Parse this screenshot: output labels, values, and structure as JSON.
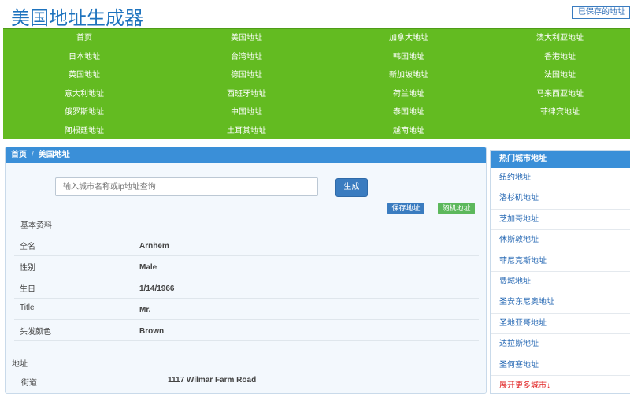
{
  "header": {
    "title": "美国地址生成器",
    "saved_label": "已保存的地址"
  },
  "nav": {
    "items": [
      "首页",
      "美国地址",
      "加拿大地址",
      "澳大利亚地址",
      "日本地址",
      "台湾地址",
      "韩国地址",
      "香港地址",
      "英国地址",
      "德国地址",
      "新加坡地址",
      "法国地址",
      "意大利地址",
      "西班牙地址",
      "荷兰地址",
      "马来西亚地址",
      "俄罗斯地址",
      "中国地址",
      "泰国地址",
      "菲律宾地址",
      "阿根廷地址",
      "土耳其地址",
      "越南地址"
    ]
  },
  "breadcrumb": {
    "home": "首页",
    "separator": "/",
    "current": "美国地址"
  },
  "search": {
    "placeholder": "输入城市名称或ip地址查询",
    "button": "生成"
  },
  "actions": {
    "save": "保存地址",
    "random": "随机地址"
  },
  "basic": {
    "heading": "基本资料",
    "rows": [
      {
        "label": "全名",
        "value": "Arnhem"
      },
      {
        "label": "性别",
        "value": "Male"
      },
      {
        "label": "生日",
        "value": "1/14/1966"
      },
      {
        "label": "Title",
        "value": "Mr."
      },
      {
        "label": "头发颜色",
        "value": "Brown"
      }
    ]
  },
  "address": {
    "heading": "地址",
    "street_label": "街道",
    "street_value": "1117  Wilmar Farm Road"
  },
  "sidebar": {
    "heading": "热门城市地址",
    "items": [
      "纽约地址",
      "洛杉矶地址",
      "芝加哥地址",
      "休斯敦地址",
      "菲尼克斯地址",
      "费城地址",
      "圣安东尼奥地址",
      "圣地亚哥地址",
      "达拉斯地址",
      "圣何塞地址"
    ],
    "more": "展开更多城市↓"
  }
}
